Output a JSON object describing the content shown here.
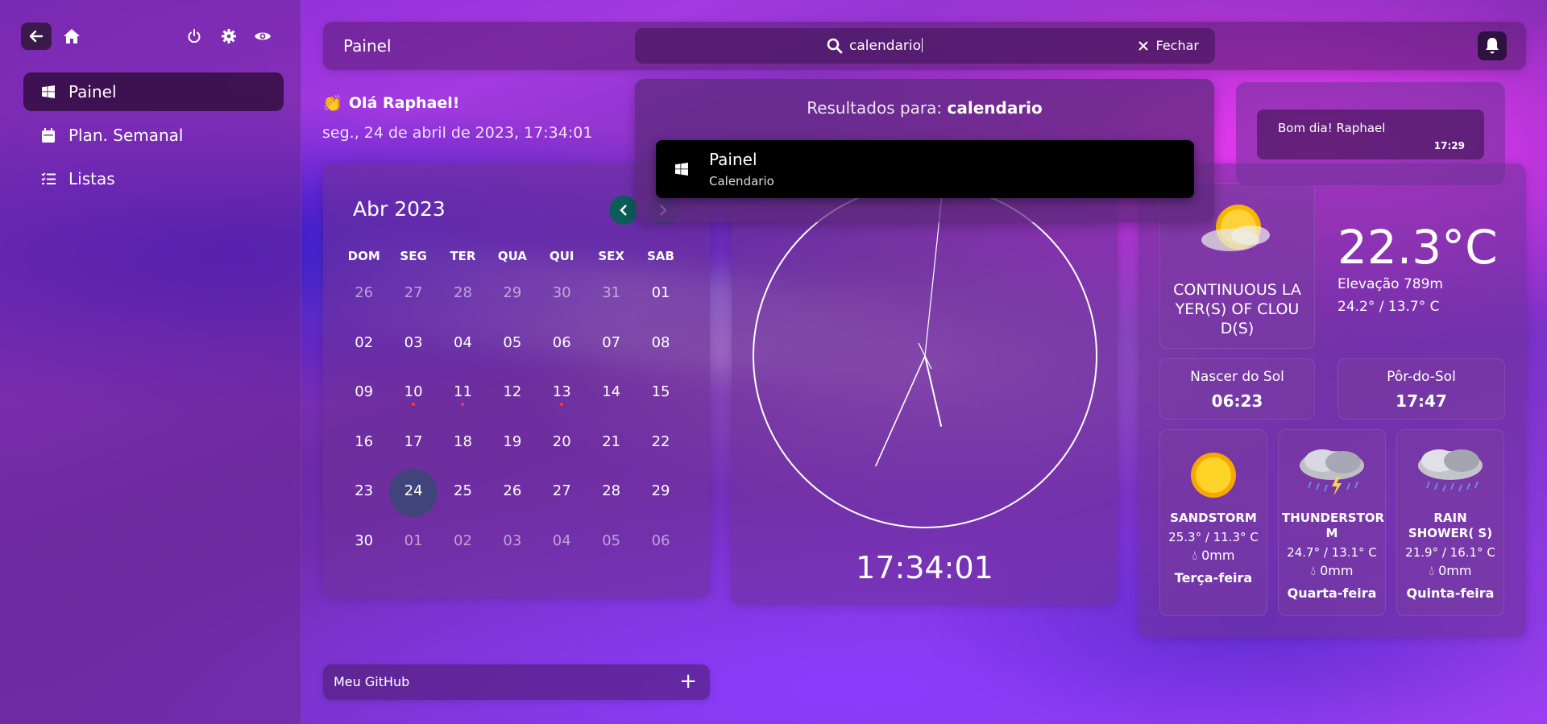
{
  "sidebar": {
    "items": [
      {
        "label": "Painel",
        "icon": "windows-icon",
        "active": true
      },
      {
        "label": "Plan. Semanal",
        "icon": "calendar-icon",
        "active": false
      },
      {
        "label": "Listas",
        "icon": "list-check-icon",
        "active": false
      }
    ]
  },
  "header": {
    "title": "Painel",
    "search_value": "calendario",
    "close_label": "Fechar"
  },
  "search_results": {
    "prefix": "Resultados para: ",
    "query": "calendario",
    "items": [
      {
        "title": "Painel",
        "subtitle": "Calendario"
      }
    ]
  },
  "greeting": {
    "text": "Olá Raphael!",
    "datetime": "seg., 24 de abril de 2023, 17:34:01"
  },
  "calendar": {
    "title": "Abr 2023",
    "weekdays": [
      "DOM",
      "SEG",
      "TER",
      "QUA",
      "QUI",
      "SEX",
      "SAB"
    ],
    "weeks": [
      [
        {
          "d": "26",
          "m": true
        },
        {
          "d": "27",
          "m": true
        },
        {
          "d": "28",
          "m": true
        },
        {
          "d": "29",
          "m": true
        },
        {
          "d": "30",
          "m": true
        },
        {
          "d": "31",
          "m": true
        },
        {
          "d": "01"
        }
      ],
      [
        {
          "d": "02"
        },
        {
          "d": "03"
        },
        {
          "d": "04"
        },
        {
          "d": "05"
        },
        {
          "d": "06"
        },
        {
          "d": "07"
        },
        {
          "d": "08"
        }
      ],
      [
        {
          "d": "09"
        },
        {
          "d": "10",
          "dot": true
        },
        {
          "d": "11",
          "dot": true
        },
        {
          "d": "12"
        },
        {
          "d": "13",
          "dot": true
        },
        {
          "d": "14"
        },
        {
          "d": "15"
        }
      ],
      [
        {
          "d": "16"
        },
        {
          "d": "17"
        },
        {
          "d": "18"
        },
        {
          "d": "19"
        },
        {
          "d": "20"
        },
        {
          "d": "21"
        },
        {
          "d": "22"
        }
      ],
      [
        {
          "d": "23"
        },
        {
          "d": "24",
          "today": true
        },
        {
          "d": "25"
        },
        {
          "d": "26"
        },
        {
          "d": "27"
        },
        {
          "d": "28"
        },
        {
          "d": "29"
        }
      ],
      [
        {
          "d": "30"
        },
        {
          "d": "01",
          "m": true
        },
        {
          "d": "02",
          "m": true
        },
        {
          "d": "03",
          "m": true
        },
        {
          "d": "04",
          "m": true
        },
        {
          "d": "05",
          "m": true
        },
        {
          "d": "06",
          "m": true
        }
      ]
    ]
  },
  "clock": {
    "time": "17:34:01",
    "hours": 17,
    "minutes": 34,
    "seconds": 1
  },
  "notification": {
    "text": "Bom dia! Raphael",
    "time": "17:29"
  },
  "weather": {
    "current": {
      "description": "CONTINUOUS LA YER(S) OF CLOU D(S)",
      "temp": "22.3°C",
      "elevation": "Elevação 789m",
      "minmax": "24.2° / 13.7° C",
      "icon": "sun-cloud-icon"
    },
    "sunrise": {
      "label": "Nascer do Sol",
      "value": "06:23"
    },
    "sunset": {
      "label": "Pôr-do-Sol",
      "value": "17:47"
    },
    "forecast": [
      {
        "name": "SANDSTORM",
        "temp": "25.3° / 11.3° C",
        "precip": "0mm",
        "day": "Terça-feira",
        "icon": "sun-icon"
      },
      {
        "name": "THUNDERSTOR M",
        "temp": "24.7° / 13.1° C",
        "precip": "0mm",
        "day": "Quarta-feira",
        "icon": "thunderstorm-icon"
      },
      {
        "name": "RAIN SHOWER( S)",
        "temp": "21.9° / 16.1° C",
        "precip": "0mm",
        "day": "Quinta-feira",
        "icon": "rain-icon"
      }
    ]
  },
  "github": {
    "label": "Meu GitHub",
    "plus": "+"
  },
  "colors": {
    "accent_teal": "#0c5c5a",
    "event_dot": "#ff3a3a"
  }
}
